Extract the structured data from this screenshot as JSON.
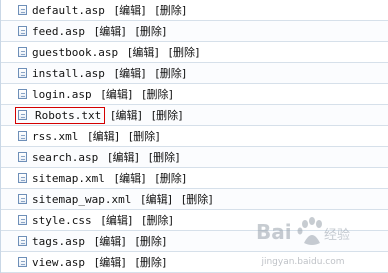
{
  "files": [
    {
      "name": "default.asp",
      "edit": "[编辑]",
      "delete": "[删除]"
    },
    {
      "name": "feed.asp",
      "edit": "[编辑]",
      "delete": "[删除]"
    },
    {
      "name": "guestbook.asp",
      "edit": "[编辑]",
      "delete": "[删除]"
    },
    {
      "name": "install.asp",
      "edit": "[编辑]",
      "delete": "[删除]"
    },
    {
      "name": "login.asp",
      "edit": "[编辑]",
      "delete": "[删除]"
    },
    {
      "name": "Robots.txt",
      "edit": "[编辑]",
      "delete": "[删除]"
    },
    {
      "name": "rss.xml",
      "edit": "[编辑]",
      "delete": "[删除]"
    },
    {
      "name": "search.asp",
      "edit": "[编辑]",
      "delete": "[删除]"
    },
    {
      "name": "sitemap.xml",
      "edit": "[编辑]",
      "delete": "[删除]"
    },
    {
      "name": "sitemap_wap.xml",
      "edit": "[编辑]",
      "delete": "[删除]"
    },
    {
      "name": "style.css",
      "edit": "[编辑]",
      "delete": "[删除]"
    },
    {
      "name": "tags.asp",
      "edit": "[编辑]",
      "delete": "[删除]"
    },
    {
      "name": "view.asp",
      "edit": "[编辑]",
      "delete": "[删除]"
    }
  ],
  "highlighted_row": 5,
  "watermark": {
    "text": "jingyan.baidu.com",
    "logo_text": "Bai 经验"
  },
  "colors": {
    "highlight_border": "#d40000",
    "row_border": "#d6e0ea",
    "icon_border": "#6e8fb8"
  }
}
